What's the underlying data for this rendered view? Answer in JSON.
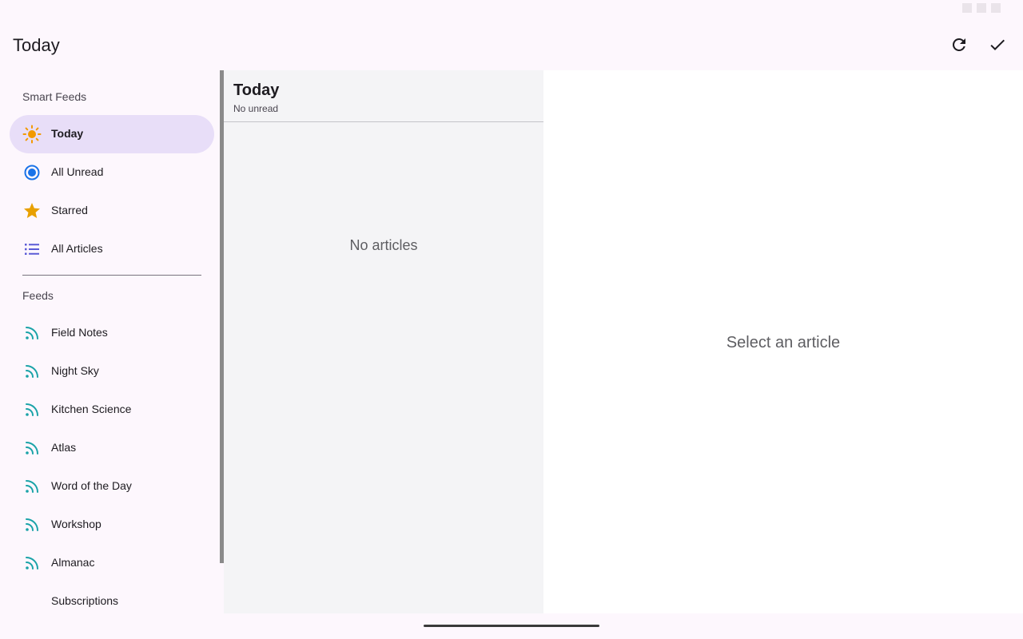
{
  "app_bar": {
    "title": "Today",
    "refresh_icon": "refresh-icon",
    "mark_read_icon": "check-icon"
  },
  "drawer": {
    "smart_feeds_header": "Smart Feeds",
    "smart_feeds": [
      {
        "label": "Today",
        "icon": "sun-icon",
        "selected": true
      },
      {
        "label": "All Unread",
        "icon": "radio-dot-icon"
      },
      {
        "label": "Starred",
        "icon": "star-icon"
      },
      {
        "label": "All Articles",
        "icon": "list-icon"
      }
    ],
    "feeds_header": "Feeds",
    "feeds": [
      {
        "label": "Field Notes",
        "icon": "rss-icon"
      },
      {
        "label": "Night Sky",
        "icon": "rss-icon"
      },
      {
        "label": "Kitchen Science",
        "icon": "rss-icon"
      },
      {
        "label": "Atlas",
        "icon": "rss-icon"
      },
      {
        "label": "Word of the Day",
        "icon": "rss-icon"
      },
      {
        "label": "Workshop",
        "icon": "rss-icon"
      },
      {
        "label": "Almanac",
        "icon": "rss-icon"
      }
    ],
    "subscriptions_label": "Subscriptions"
  },
  "article_list": {
    "title": "Today",
    "subtitle": "No unread",
    "empty_text": "No articles"
  },
  "detail": {
    "empty_text": "Select an article"
  },
  "colors": {
    "sun": "#f29900",
    "radio": "#1a73e8",
    "star": "#e8a000",
    "list": "#5b5bd6",
    "rss": "#1aa3a8",
    "selected_bg": "#e8def8"
  }
}
